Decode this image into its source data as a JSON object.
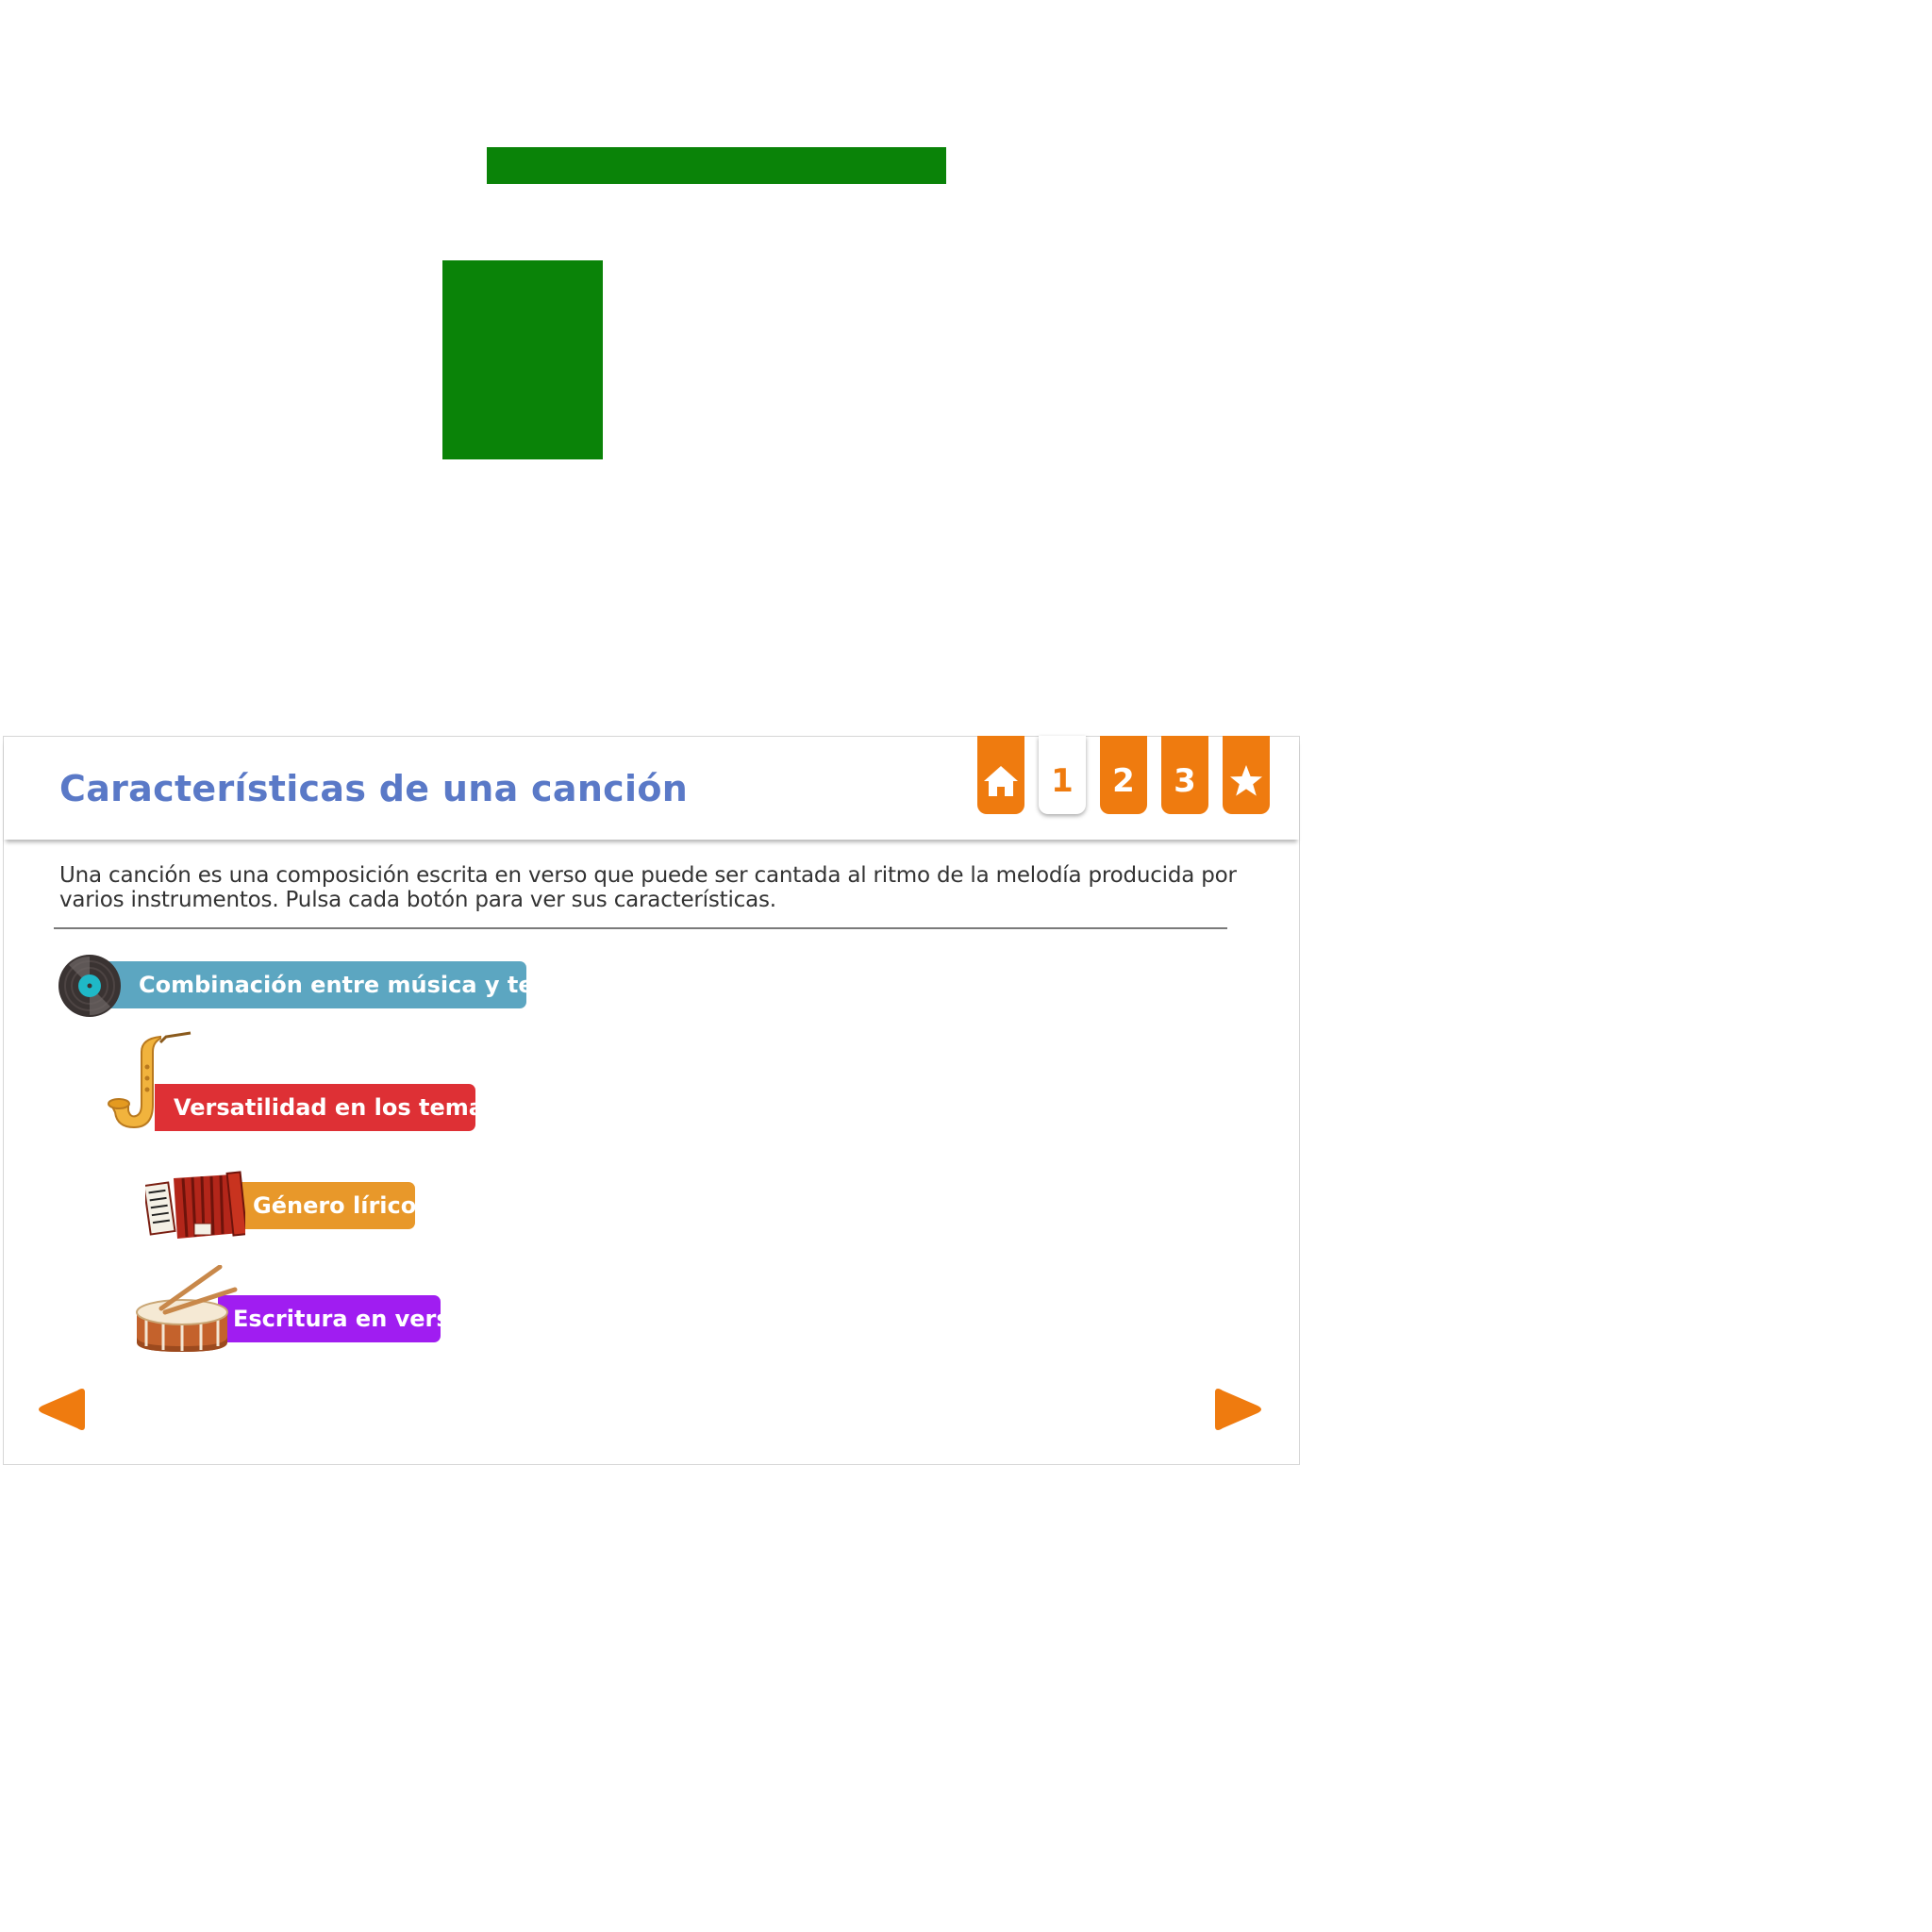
{
  "panel": {
    "title": "Características de una canción",
    "intro": "Una canción es una composición escrita en verso que puede ser cantada al ritmo de la melodía producida por varios instrumentos. Pulsa cada botón para ver sus características.",
    "tabs": [
      {
        "id": "home",
        "icon": "home-icon",
        "label": ""
      },
      {
        "id": "1",
        "label": "1",
        "active": true
      },
      {
        "id": "2",
        "label": "2"
      },
      {
        "id": "3",
        "label": "3"
      },
      {
        "id": "star",
        "icon": "star-icon",
        "label": ""
      }
    ],
    "buttons": [
      {
        "label": "Combinación entre música y texto",
        "icon": "vinyl-record-icon",
        "color": "#5ca6c1"
      },
      {
        "label": "Versatilidad en los temas",
        "icon": "saxophone-icon",
        "color": "#de3035"
      },
      {
        "label": "Género lírico",
        "icon": "accordion-icon",
        "color": "#e8982a"
      },
      {
        "label": "Escritura en verso",
        "icon": "drum-icon",
        "color": "#a01df1"
      }
    ]
  },
  "colors": {
    "accent": "#ef7b0f",
    "title": "#5a79c7",
    "decor_green": "#0a8308"
  }
}
